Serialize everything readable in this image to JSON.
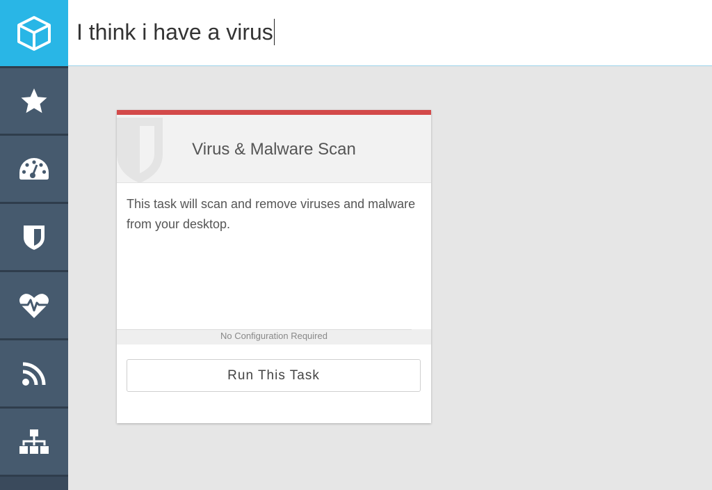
{
  "search": {
    "value": "I think i have a virus"
  },
  "sidebar": {
    "items": [
      {
        "icon": "star-icon"
      },
      {
        "icon": "dashboard-gauge-icon"
      },
      {
        "icon": "shield-icon"
      },
      {
        "icon": "heartbeat-icon"
      },
      {
        "icon": "rss-feed-icon"
      },
      {
        "icon": "network-sitemap-icon"
      }
    ]
  },
  "task_card": {
    "title": "Virus & Malware Scan",
    "description": "This task will scan and remove viruses and malware from your desktop.",
    "config_status": "No Configuration Required",
    "run_button_label": "Run This Task"
  },
  "colors": {
    "brand_blue": "#29b6e6",
    "sidebar": "#465a6e",
    "card_accent_red": "#d34a4a",
    "background": "#e6e6e6"
  }
}
